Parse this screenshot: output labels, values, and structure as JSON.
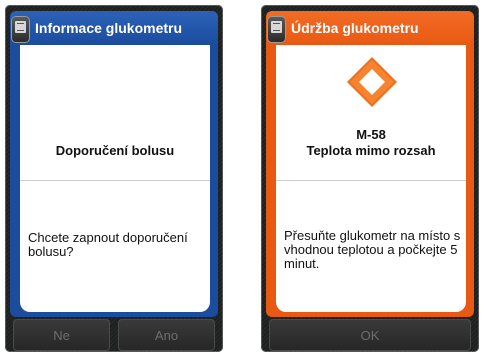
{
  "left_screen": {
    "title": "Informace glukometru",
    "heading": "Doporučení bolusu",
    "body": "Chcete zapnout doporučení bolusu?",
    "buttons": {
      "no_label": "Ne",
      "yes_label": "Ano"
    },
    "accent_color": "#1b4c9e",
    "icon": "meter-icon"
  },
  "right_screen": {
    "title": "Údržba glukometru",
    "code": "M-58",
    "heading": "Teplota mimo rozsah",
    "body": "Přesuňte glukometr na místo s vhodnou teplotou a počkejte 5 minut.",
    "buttons": {
      "ok_label": "OK"
    },
    "accent_color": "#e85a14",
    "icon": "warning-diamond-icon"
  }
}
